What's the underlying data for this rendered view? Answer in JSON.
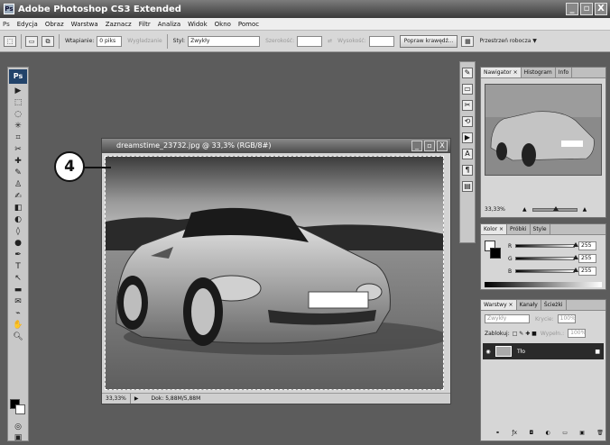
{
  "app": {
    "title": "Adobe Photoshop CS3 Extended",
    "window_buttons": [
      "_",
      "▫",
      "X"
    ]
  },
  "menu": {
    "ps_label": "Ps",
    "items": [
      "Edycja",
      "Obraz",
      "Warstwa",
      "Zaznacz",
      "Filtr",
      "Analiza",
      "Widok",
      "Okno",
      "Pomoc"
    ]
  },
  "options": {
    "feather_label": "Wtapianie:",
    "feather_value": "0 piks",
    "antialias_label": "Wygładzanie",
    "style_label": "Styl:",
    "style_value": "Zwykły",
    "width_label": "Szerokość:",
    "height_label": "Wysokość:",
    "refine_button": "Popraw krawędź...",
    "workspace_button": "Przestrzeń robocza ▼"
  },
  "toolbox": {
    "logo": "Ps"
  },
  "document": {
    "title": "dreamstime_23732.jpg @ 33,3% (RGB/8#)",
    "zoom": "33,33%",
    "doc_info": "Dok: 5,88M/5,88M",
    "buttons": [
      "_",
      "▫",
      "X"
    ]
  },
  "callout": {
    "number": "4"
  },
  "navigator": {
    "tabs": [
      "Nawigator ×",
      "Histogram",
      "Info"
    ],
    "zoom": "33,33%"
  },
  "color": {
    "tabs": [
      "Kolor ×",
      "Próbki",
      "Style"
    ],
    "channels": [
      {
        "label": "R",
        "value": "255",
        "fraction": 1
      },
      {
        "label": "G",
        "value": "255",
        "fraction": 1
      },
      {
        "label": "B",
        "value": "255",
        "fraction": 1
      }
    ]
  },
  "layers": {
    "tabs": [
      "Warstwy ×",
      "Kanały",
      "Ścieżki"
    ],
    "blend_mode": "Zwykły",
    "opacity_label": "Krycie:",
    "opacity_value": "100%",
    "lock_label": "Zablokuj:",
    "fill_label": "Wypełn.:",
    "fill_value": "100%",
    "layer_name": "Tło"
  },
  "colors": {
    "titlebar": "#3a3a3a",
    "workspace": "#5c5c5c",
    "panel": "#d6d6d6",
    "toolbox": "#c8c8c8"
  },
  "icons": [
    "photoshop-icon",
    "marquee-icon",
    "move-icon",
    "lasso-icon",
    "magic-wand-icon",
    "crop-icon",
    "eyedropper-icon",
    "healing-icon",
    "brush-icon",
    "clone-icon",
    "eraser-icon",
    "gradient-icon",
    "dodge-icon",
    "pen-icon",
    "type-icon",
    "path-select-icon",
    "shape-icon",
    "hand-icon",
    "zoom-icon",
    "quick-mask-icon"
  ]
}
